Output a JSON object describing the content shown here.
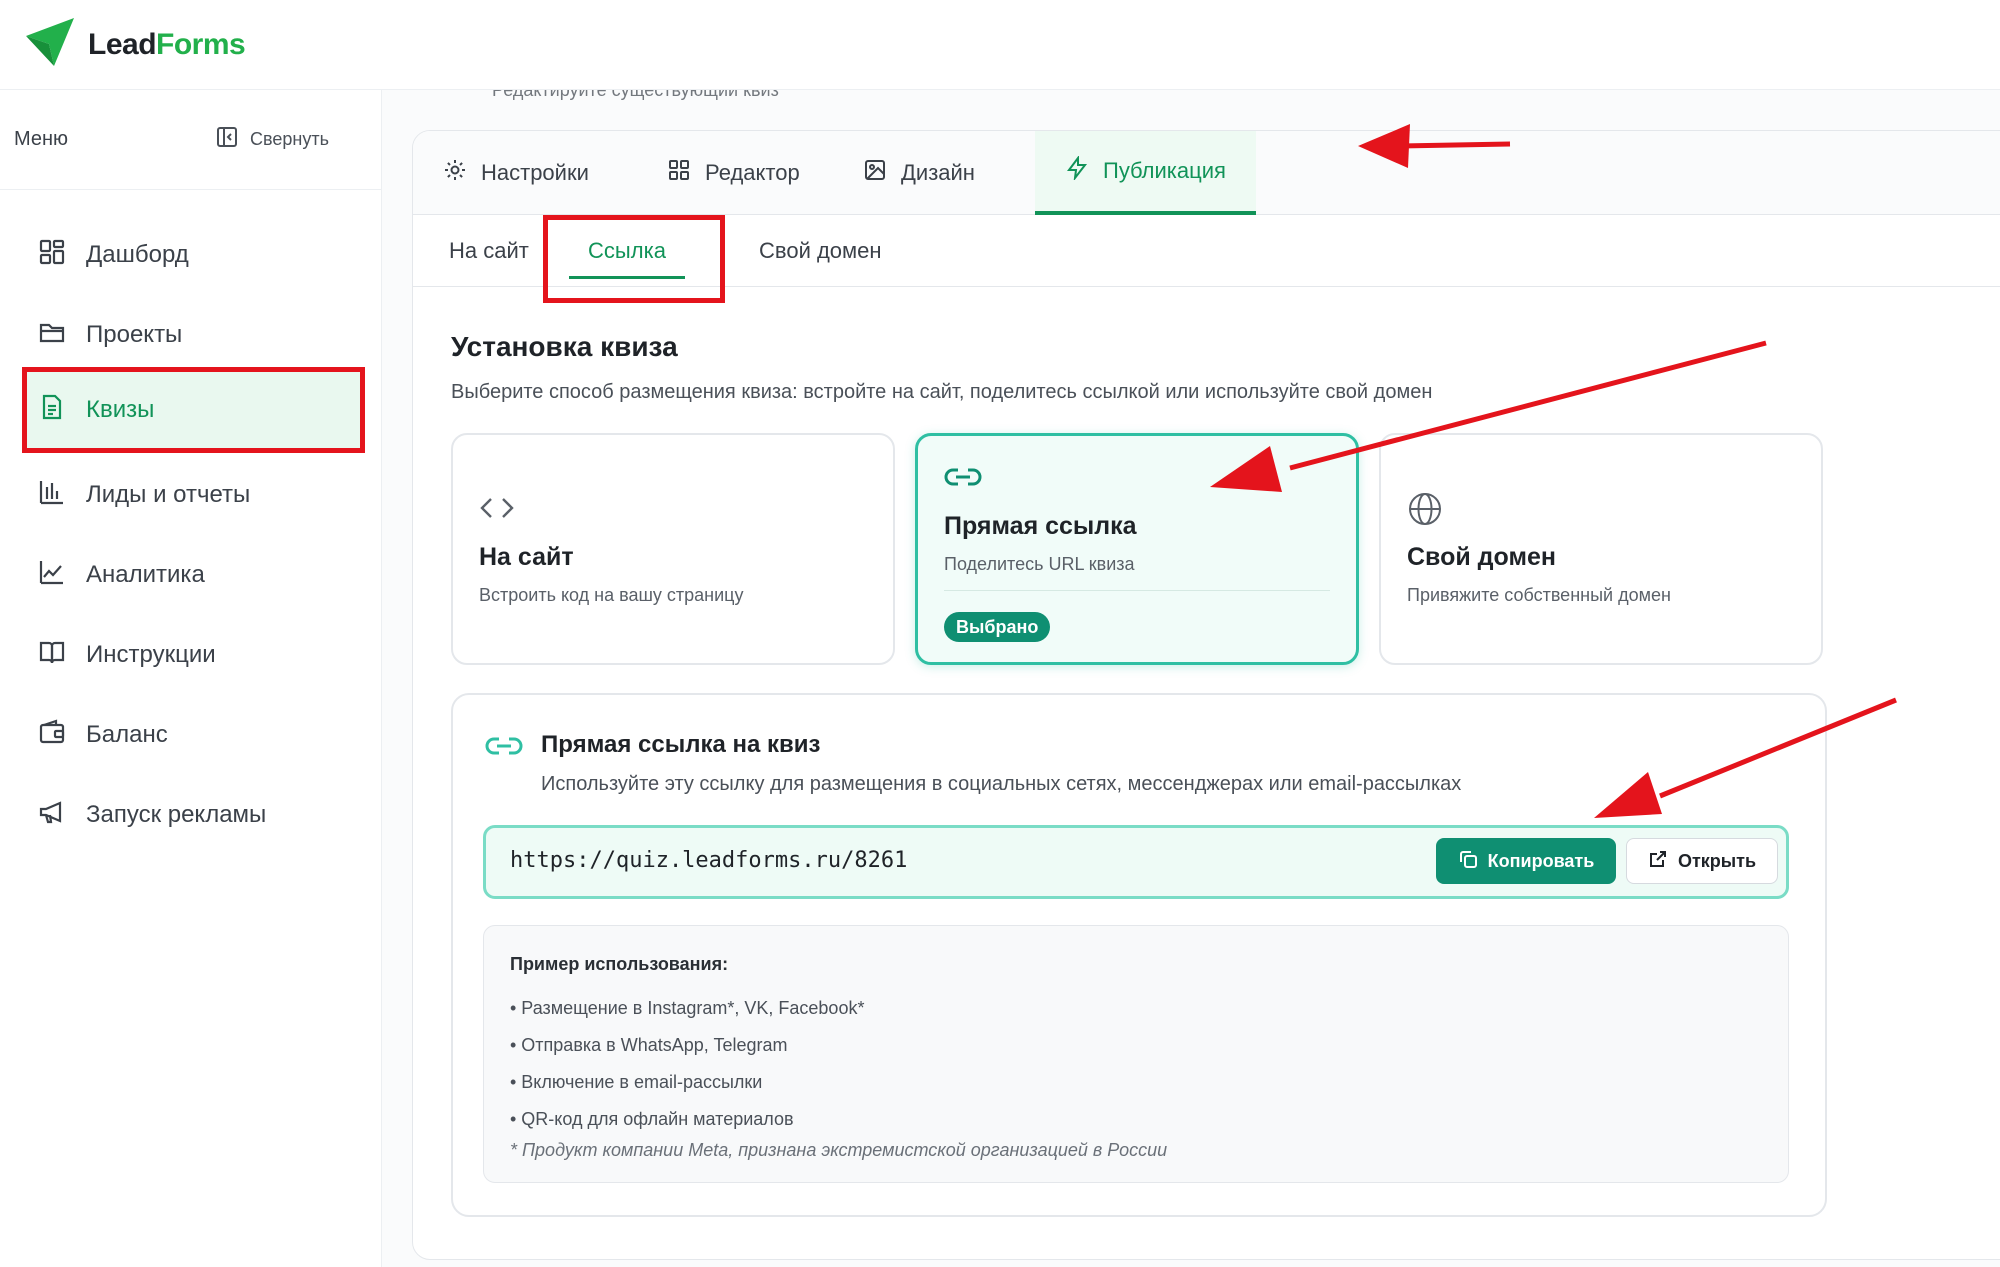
{
  "brand": {
    "lead": "Lead",
    "forms": "Forms",
    "logo_color": "#22b04b"
  },
  "sidebar": {
    "menu_label": "Меню",
    "collapse_label": "Свернуть",
    "items": [
      {
        "label": "Дашборд",
        "icon": "dashboard-icon"
      },
      {
        "label": "Проекты",
        "icon": "folder-icon"
      },
      {
        "label": "Квизы",
        "icon": "document-icon",
        "active": true
      },
      {
        "label": "Лиды и отчеты",
        "icon": "bar-chart-icon"
      },
      {
        "label": "Аналитика",
        "icon": "line-chart-icon"
      },
      {
        "label": "Инструкции",
        "icon": "book-icon"
      },
      {
        "label": "Баланс",
        "icon": "wallet-icon"
      },
      {
        "label": "Запуск рекламы",
        "icon": "megaphone-icon"
      }
    ]
  },
  "main": {
    "ghost_text": "Редактируйте существующий квиз",
    "tabs": [
      {
        "label": "Настройки",
        "icon": "gear-icon"
      },
      {
        "label": "Редактор",
        "icon": "grid-icon"
      },
      {
        "label": "Дизайн",
        "icon": "image-icon"
      },
      {
        "label": "Публикация",
        "icon": "lightning-icon",
        "active": true
      }
    ],
    "subtabs": [
      {
        "label": "На сайт"
      },
      {
        "label": "Ссылка",
        "active": true
      },
      {
        "label": "Свой домен"
      }
    ],
    "section_title": "Установка квиза",
    "section_desc": "Выберите способ размещения квиза: встройте на сайт, поделитесь ссылкой или используйте свой домен",
    "options": [
      {
        "title": "На сайт",
        "subtitle": "Встроить код на вашу страницу",
        "icon": "code-icon"
      },
      {
        "title": "Прямая ссылка",
        "subtitle": "Поделитесь URL квиза",
        "icon": "link-icon",
        "selected": true,
        "badge": "Выбрано"
      },
      {
        "title": "Свой домен",
        "subtitle": "Привяжите собственный домен",
        "icon": "globe-icon"
      }
    ],
    "link_panel": {
      "title": "Прямая ссылка на квиз",
      "desc": "Используйте эту ссылку для размещения в социальных сетях, мессенджерах или email-рассылках",
      "url": "https://quiz.leadforms.ru/8261",
      "copy_label": "Копировать",
      "open_label": "Открыть",
      "example_title": "Пример использования:",
      "examples": [
        "• Размещение в Instagram*, VK, Facebook*",
        "• Отправка в WhatsApp, Telegram",
        "• Включение в email-рассылки",
        "• QR-код для офлайн материалов"
      ],
      "note": "* Продукт компании Meta, признана экстремистской организацией в России"
    }
  },
  "colors": {
    "accent": "#119358",
    "teal": "#0f8f72",
    "annotation_red": "#e4141c"
  }
}
